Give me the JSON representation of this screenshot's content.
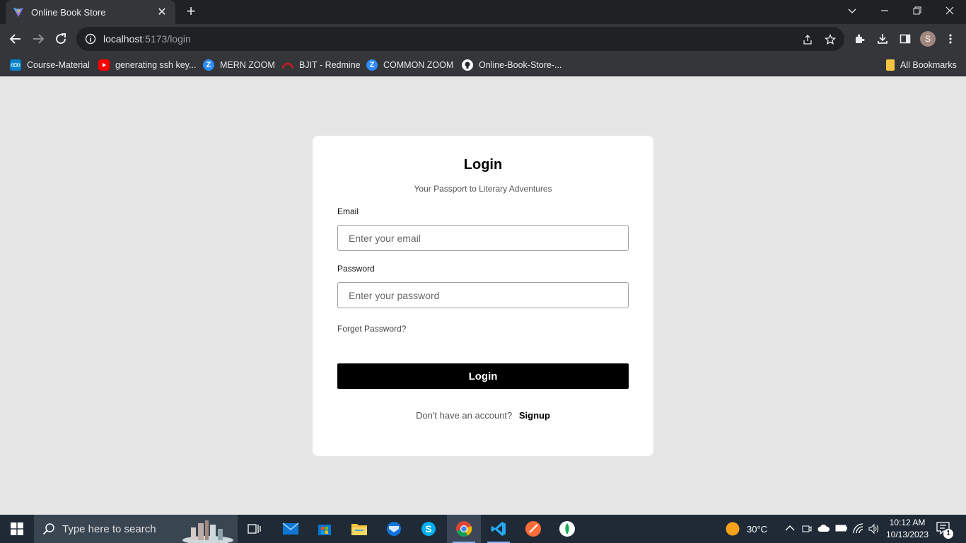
{
  "browser": {
    "tab": {
      "title": "Online Book Store"
    },
    "address": {
      "host": "localhost",
      "path": ":5173/login"
    },
    "avatar_letter": "S",
    "bookmarks": [
      {
        "label": "Course-Material",
        "icon": "nextcloud-icon",
        "color": "#0082c9"
      },
      {
        "label": "generating ssh key...",
        "icon": "youtube-icon",
        "color": "#ff0000"
      },
      {
        "label": "MERN ZOOM",
        "icon": "zoom-icon",
        "color": "#2d8cff"
      },
      {
        "label": "BJIT - Redmine",
        "icon": "redmine-icon",
        "color": "#b32024"
      },
      {
        "label": "COMMON ZOOM",
        "icon": "zoom-icon",
        "color": "#2d8cff"
      },
      {
        "label": "Online-Book-Store-...",
        "icon": "github-icon",
        "color": "#ffffff"
      }
    ],
    "all_bookmarks": "All Bookmarks"
  },
  "login": {
    "title": "Login",
    "subtitle": "Your Passport to Literary Adventures",
    "email_label": "Email",
    "email_placeholder": "Enter your email",
    "password_label": "Password",
    "password_placeholder": "Enter your password",
    "forget_password": "Forget Password?",
    "submit_label": "Login",
    "no_account_text": "Don't have an account?",
    "signup_label": "Signup"
  },
  "taskbar": {
    "search_placeholder": "Type here to search",
    "temperature": "30°C",
    "time": "10:12 AM",
    "date": "10/13/2023",
    "notification_count": "1"
  },
  "colors": {
    "page_bg": "#e6e6e6",
    "card_bg": "#ffffff",
    "button_bg": "#000000",
    "chrome_dark": "#202124",
    "chrome_toolbar": "#35363a"
  }
}
